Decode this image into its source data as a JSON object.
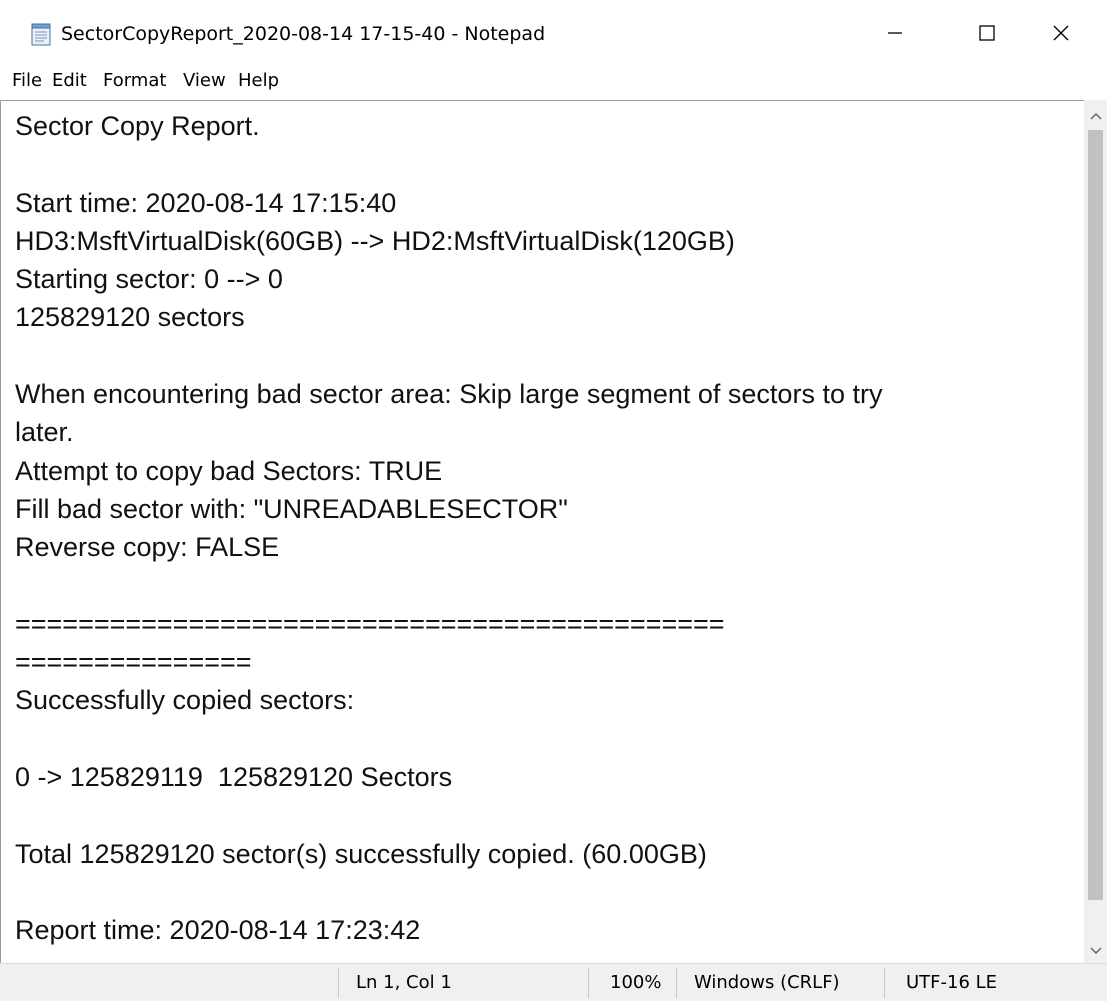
{
  "window": {
    "title": "SectorCopyReport_2020-08-14 17-15-40 - Notepad",
    "app_icon": "notepad-icon",
    "controls": [
      "minimize-icon",
      "maximize-icon",
      "close-icon"
    ]
  },
  "menu": {
    "file": "File",
    "edit": "Edit",
    "format": "Format",
    "view": "View",
    "help": "Help"
  },
  "document": {
    "lines": [
      "Sector Copy Report.",
      "",
      "Start time: 2020-08-14 17:15:40",
      "HD3:MsftVirtualDisk(60GB) --> HD2:MsftVirtualDisk(120GB)",
      "Starting sector: 0 --> 0",
      "125829120 sectors",
      "",
      "When encountering bad sector area: Skip large segment of sectors to try",
      "later.",
      "Attempt to copy bad Sectors: TRUE",
      "Fill bad sector with: \"UNREADABLESECTOR\"",
      "Reverse copy: FALSE",
      "",
      "=============================================",
      "===============",
      "Successfully copied sectors:",
      "",
      "0 -> 125829119  125829120 Sectors",
      "",
      "Total 125829120 sector(s) successfully copied. (60.00GB)",
      "",
      "Report time: 2020-08-14 17:23:42"
    ]
  },
  "statusbar": {
    "position": "Ln 1, Col 1",
    "zoom": "100%",
    "line_ending": "Windows (CRLF)",
    "encoding": "UTF-16 LE"
  },
  "scrollbar": {
    "up_icon": "scroll-up-arrow-icon",
    "down_icon": "scroll-down-arrow-icon"
  }
}
